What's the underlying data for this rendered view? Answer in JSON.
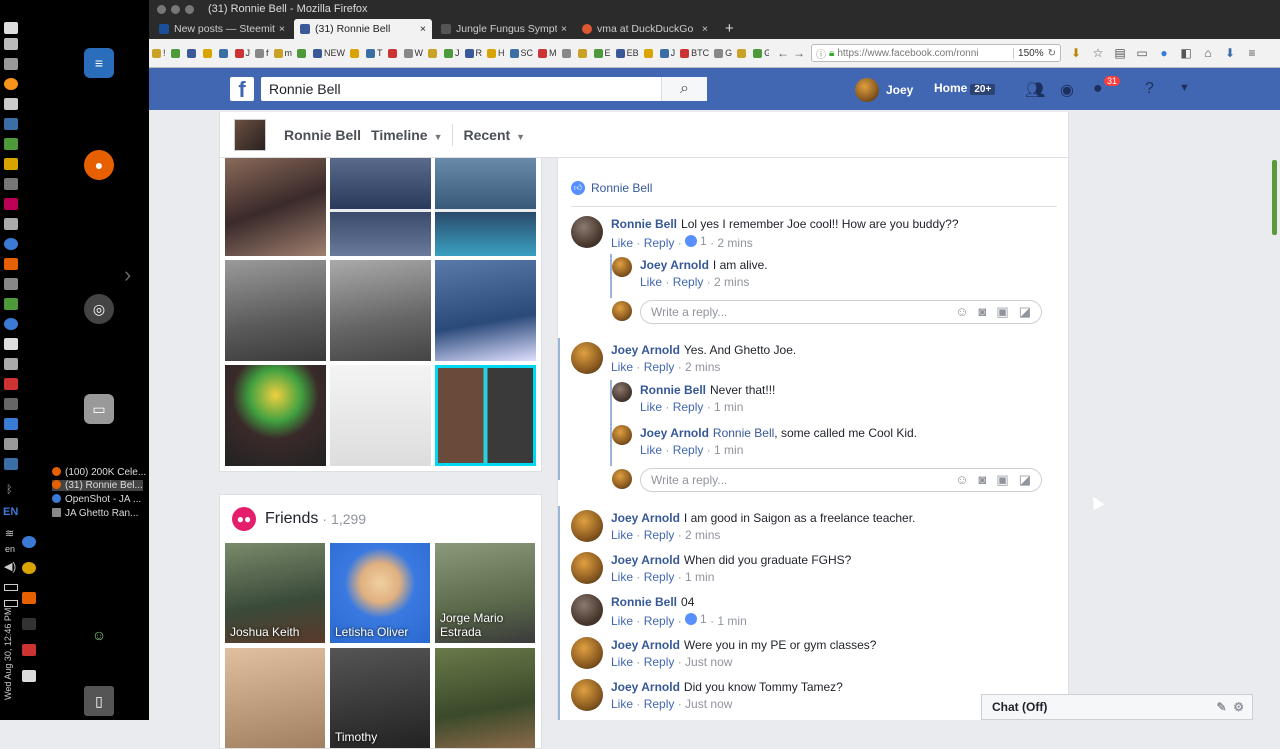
{
  "window_title": "(31) Ronnie Bell - Mozilla Firefox",
  "tabs": [
    {
      "label": "New posts — Steemit",
      "color": "#1a5099",
      "active": false
    },
    {
      "label": "(31) Ronnie Bell",
      "color": "#3b5998",
      "active": true
    },
    {
      "label": "Jungle Fungus Sympt",
      "color": "#555555",
      "active": false
    },
    {
      "label": "vma at DuckDuckGo",
      "color": "#de5833",
      "active": false
    }
  ],
  "new_tab": "+",
  "bookmarks": [
    "!",
    "",
    "",
    "",
    "",
    "J",
    "f",
    "m",
    "",
    "NEW",
    "",
    "T",
    "",
    "W",
    "",
    "J",
    "R",
    "H",
    "SC",
    "M",
    "",
    "",
    "E",
    "EB",
    "",
    "J",
    "BTC",
    "G",
    "",
    "G",
    "WOW"
  ],
  "url": "https://www.facebook.com/ronni",
  "zoom": "150%",
  "dock": {
    "windows": [
      {
        "label": "(100) 200K Cele...",
        "color": "#e66000",
        "selected": false
      },
      {
        "label": "(31) Ronnie Bel...",
        "color": "#e66000",
        "selected": true
      },
      {
        "label": "OpenShot - JA ...",
        "color": "#3a7bd5",
        "selected": false
      },
      {
        "label": "JA Ghetto Ran...",
        "color": "#888888",
        "selected": false
      }
    ],
    "lang": "EN",
    "lang_small": "en",
    "datetime": "Wed Aug 30, 12:46 PM"
  },
  "facebook": {
    "logo": "f",
    "search_value": "Ronnie Bell",
    "user": "Joey",
    "home": "Home",
    "home_badge": "20+",
    "notif_count": "31",
    "subnav": {
      "name": "Ronnie Bell",
      "timeline": "Timeline",
      "recent": "Recent"
    },
    "friends": {
      "title": "Friends",
      "count": "1,299",
      "items": [
        {
          "name": "Joshua Keith"
        },
        {
          "name": "Letisha Oliver"
        },
        {
          "name": "Jorge Mario Estrada"
        },
        {
          "name": ""
        },
        {
          "name": "Timothy"
        },
        {
          "name": ""
        }
      ]
    },
    "like_by": "Ronnie Bell",
    "comments": [
      {
        "name": "Ronnie Bell",
        "text": "Lol yes I remember Joe cool!! How are you buddy??",
        "like": "Like",
        "reply": "Reply",
        "reactions": "1",
        "time": "2 mins"
      },
      {
        "name": "Joey Arnold",
        "text": "I am alive.",
        "like": "Like",
        "reply": "Reply",
        "time": "2 mins"
      },
      {
        "name": "Joey Arnold",
        "text": "Yes. And Ghetto Joe.",
        "like": "Like",
        "reply": "Reply",
        "time": "2 mins"
      },
      {
        "name": "Ronnie Bell",
        "text": "Never that!!!",
        "like": "Like",
        "reply": "Reply",
        "time": "1 min"
      },
      {
        "name": "Joey Arnold",
        "mention": "Ronnie Bell",
        "text": ", some called me Cool Kid.",
        "like": "Like",
        "reply": "Reply",
        "time": "1 min"
      },
      {
        "name": "Joey Arnold",
        "text": "I am good in Saigon as a freelance teacher.",
        "like": "Like",
        "reply": "Reply",
        "time": "2 mins"
      },
      {
        "name": "Joey Arnold",
        "text": "When did you graduate FGHS?",
        "like": "Like",
        "reply": "Reply",
        "time": "1 min"
      },
      {
        "name": "Ronnie Bell",
        "text": "04",
        "like": "Like",
        "reply": "Reply",
        "reactions": "1",
        "time": "1 min"
      },
      {
        "name": "Joey Arnold",
        "text": "Were you in my PE or gym classes?",
        "like": "Like",
        "reply": "Reply",
        "time": "Just now"
      },
      {
        "name": "Joey Arnold",
        "text": "Did you know Tommy Tamez?",
        "like": "Like",
        "reply": "Reply",
        "time": "Just now"
      }
    ],
    "reply_placeholder": "Write a reply...",
    "chat_label": "Chat (Off)"
  }
}
